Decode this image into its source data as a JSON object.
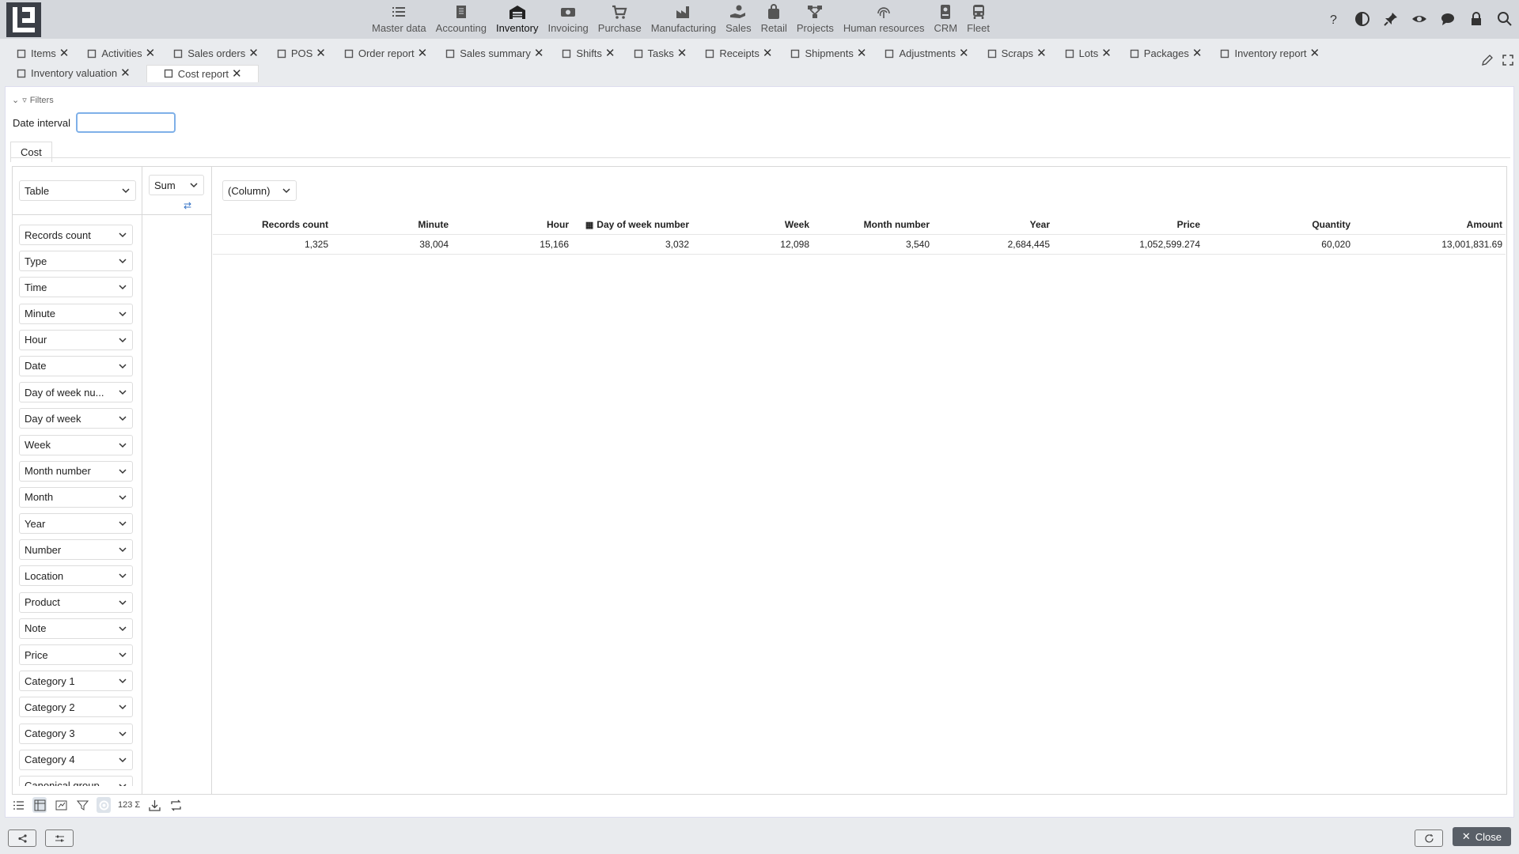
{
  "modules": [
    {
      "label": "Master data",
      "icon": "list-icon"
    },
    {
      "label": "Accounting",
      "icon": "ledger-icon"
    },
    {
      "label": "Inventory",
      "icon": "warehouse-icon",
      "active": true
    },
    {
      "label": "Invoicing",
      "icon": "money-icon"
    },
    {
      "label": "Purchase",
      "icon": "cart-icon"
    },
    {
      "label": "Manufacturing",
      "icon": "factory-icon"
    },
    {
      "label": "Sales",
      "icon": "hand-coin-icon"
    },
    {
      "label": "Retail",
      "icon": "bag-icon"
    },
    {
      "label": "Projects",
      "icon": "network-icon"
    },
    {
      "label": "Human resources",
      "icon": "fingerprint-icon"
    },
    {
      "label": "CRM",
      "icon": "id-card-icon"
    },
    {
      "label": "Fleet",
      "icon": "bus-icon"
    }
  ],
  "tabs_row1": [
    {
      "label": "Items"
    },
    {
      "label": "Activities"
    },
    {
      "label": "Sales orders"
    },
    {
      "label": "POS"
    },
    {
      "label": "Order report"
    },
    {
      "label": "Sales summary"
    },
    {
      "label": "Shifts"
    },
    {
      "label": "Tasks"
    },
    {
      "label": "Receipts"
    },
    {
      "label": "Shipments"
    },
    {
      "label": "Adjustments"
    },
    {
      "label": "Scraps"
    },
    {
      "label": "Lots"
    },
    {
      "label": "Packages"
    },
    {
      "label": "Inventory report"
    }
  ],
  "tabs_row2": [
    {
      "label": "Inventory valuation"
    },
    {
      "label": "Cost report",
      "active": true
    }
  ],
  "filters": {
    "toggle_label": "Filters",
    "date_label": "Date interval",
    "date_value": ""
  },
  "subtab": "Cost",
  "pivot": {
    "view_select": "Table",
    "agg_select": "Sum",
    "column_select": "(Column)",
    "fields": [
      "Records count",
      "Type",
      "Time",
      "Minute",
      "Hour",
      "Date",
      "Day of week nu...",
      "Day of week",
      "Week",
      "Month number",
      "Month",
      "Year",
      "Number",
      "Location",
      "Product",
      "Note",
      "Price",
      "Category 1",
      "Category 2",
      "Category 3",
      "Category 4",
      "Canonical group"
    ],
    "headers": [
      "Records count",
      "Minute",
      "Hour",
      "Day of week number",
      "Week",
      "Month number",
      "Year",
      "Price",
      "Quantity",
      "Amount"
    ],
    "values": [
      "1,325",
      "38,004",
      "15,166",
      "3,032",
      "12,098",
      "3,540",
      "2,684,445",
      "1,052,599.274",
      "60,020",
      "13,001,831.69"
    ]
  },
  "toolbar_number_label": "123",
  "close_label": "Close"
}
